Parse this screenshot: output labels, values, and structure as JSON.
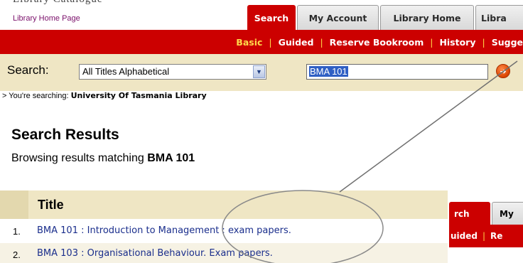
{
  "header": {
    "title_partial": "Library Catalogue",
    "home_link": "Library Home Page"
  },
  "tabs": [
    {
      "label": "Search",
      "active": true
    },
    {
      "label": "My Account",
      "active": false
    },
    {
      "label": "Library Home",
      "active": false
    },
    {
      "label": "Libra",
      "active": false
    }
  ],
  "subnav": {
    "items": [
      "Basic",
      "Guided",
      "Reserve Bookroom",
      "History",
      "Sugge"
    ],
    "active": "Basic"
  },
  "search": {
    "label": "Search:",
    "scope_select": "All Titles Alphabetical",
    "query": "BMA 101",
    "scope_prefix": "> You're searching:",
    "scope_library": "University Of Tasmania Library"
  },
  "results": {
    "heading": "Search Results",
    "browse_prefix": "Browsing results matching",
    "browse_term": "BMA 101",
    "column_title": "Title",
    "rows": [
      {
        "num": "1.",
        "title": "BMA 101 : Introduction to Management : exam papers."
      },
      {
        "num": "2.",
        "title": "BMA 103 : Organisational Behaviour. Exam papers."
      }
    ]
  },
  "inset": {
    "tabs": [
      "rch",
      "My"
    ],
    "nav": [
      "uided",
      "Re"
    ]
  },
  "colors": {
    "brand_red": "#cc0000",
    "active_highlight": "#ffd84a",
    "search_band": "#efe6c4",
    "link_blue": "#1a2e8c"
  }
}
